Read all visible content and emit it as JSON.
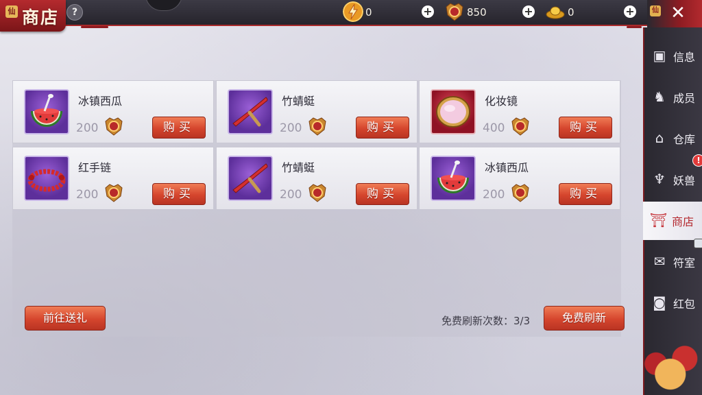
{
  "header": {
    "title": "商店",
    "help_label": "?",
    "close_label": "✕",
    "currencies": [
      {
        "icon": "lightning-coin-icon",
        "value": "0"
      },
      {
        "icon": "medal-coin-icon",
        "value": "850"
      },
      {
        "icon": "gold-ingot-icon",
        "value": "0"
      }
    ],
    "plus_label": "+"
  },
  "shop": {
    "buy_label": "购买",
    "items": [
      {
        "name": "冰镇西瓜",
        "price": "200",
        "icon": "watermelon-icon"
      },
      {
        "name": "竹蜻蜓",
        "price": "200",
        "icon": "bamboo-dragonfly-icon"
      },
      {
        "name": "化妆镜",
        "price": "400",
        "icon": "mirror-icon"
      },
      {
        "name": "红手链",
        "price": "200",
        "icon": "red-bracelet-icon"
      },
      {
        "name": "竹蜻蜓",
        "price": "200",
        "icon": "bamboo-dragonfly-icon"
      },
      {
        "name": "冰镇西瓜",
        "price": "200",
        "icon": "watermelon-icon"
      }
    ],
    "gift_button_label": "前往送礼",
    "refresh_count_text": "免费刷新次数：3/3",
    "refresh_button_label": "免费刷新"
  },
  "sidebar": {
    "items": [
      {
        "label": "信息",
        "icon": "info-icon"
      },
      {
        "label": "成员",
        "icon": "members-icon"
      },
      {
        "label": "仓库",
        "icon": "warehouse-icon"
      },
      {
        "label": "妖兽",
        "icon": "beast-icon",
        "badge": "!"
      },
      {
        "label": "商店",
        "icon": "shop-icon",
        "active": true
      },
      {
        "label": "符室",
        "icon": "talisman-icon"
      },
      {
        "label": "红包",
        "icon": "red-packet-icon"
      }
    ]
  },
  "colors": {
    "accent_red": "#b3262c",
    "button_orange": "#d5452d",
    "price_gray": "#9c98a8"
  }
}
